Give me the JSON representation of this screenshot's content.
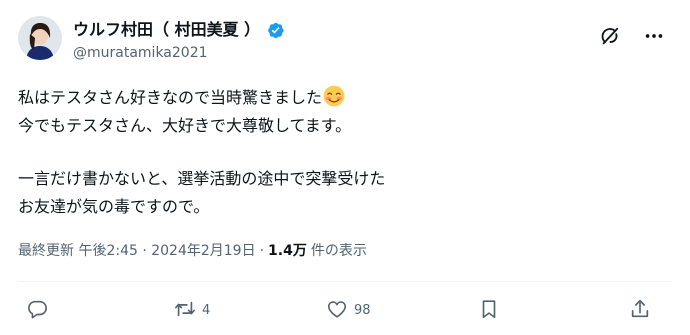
{
  "author": {
    "display_name": "ウルフ村田（ 村田美夏 ）",
    "handle": "@muratamika2021",
    "verified": true
  },
  "tweet": {
    "lines": [
      "私はテスタさん好きなので当時驚きました",
      "今でもテスタさん、大好きで大尊敬してます。",
      "一言だけ書かないと、選挙活動の途中で突撃受けた",
      "お友達が気の毒ですので。"
    ],
    "emoji": "smiling-face-with-smiling-eyes"
  },
  "meta": {
    "timestamp": "最終更新 午後2:45 · 2024年2月19日",
    "separator": "·",
    "views_count": "1.4万",
    "views_label": "件の表示"
  },
  "actions": {
    "reply_count": "",
    "retweet_count": "4",
    "like_count": "98",
    "bookmark_count": "",
    "share_count": ""
  },
  "top_icons": [
    "grok-icon",
    "more-icon"
  ],
  "colors": {
    "text": "#0f1419",
    "secondary": "#536471",
    "verified": "#1d9bf0",
    "divider": "#eff3f4"
  }
}
